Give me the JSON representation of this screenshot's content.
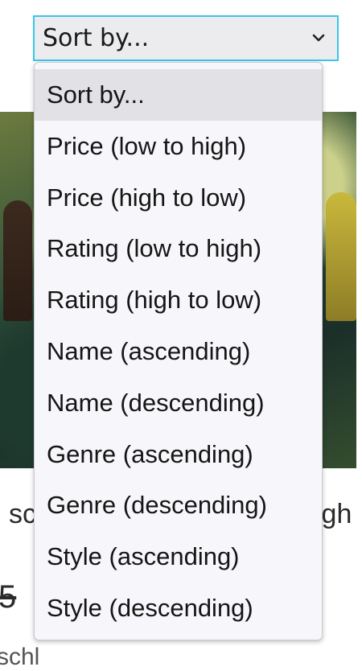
{
  "select": {
    "current_value": "Sort by...",
    "options": [
      "Sort by...",
      "Price (low to high)",
      "Price (high to low)",
      "Rating (low to high)",
      "Rating (high to low)",
      "Name (ascending)",
      "Name (descending)",
      "Genre (ascending)",
      "Genre (descending)",
      "Style (ascending)",
      "Style (descending)"
    ],
    "highlighted_index": 0
  },
  "background_card": {
    "title_left": "l sc",
    "title_right": "igh",
    "price_partial": "5",
    "sub_partial": "schl"
  },
  "colors": {
    "focus_border": "#38c7ea",
    "dropdown_bg": "#f7f7fb",
    "selected_option_bg": "#e1e1e6"
  }
}
